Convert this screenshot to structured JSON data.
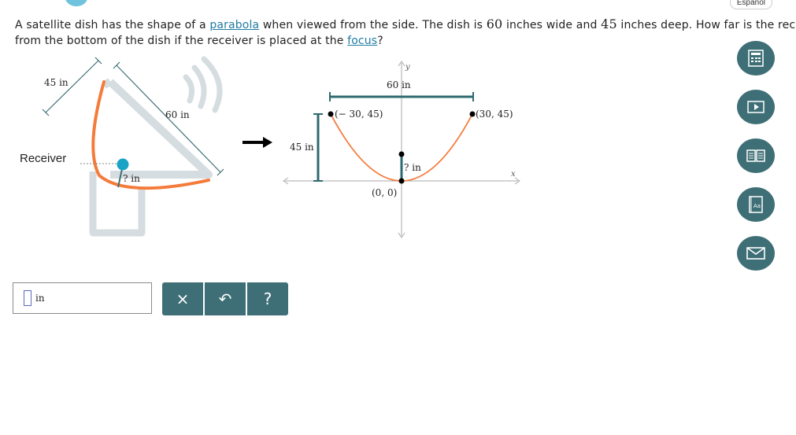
{
  "header": {
    "language_link": "Español"
  },
  "problem": {
    "part1": "A satellite dish has the shape of a ",
    "link_parabola": "parabola",
    "part2": " when viewed from the side. The dish is ",
    "width_value": "60",
    "part3": " inches wide and ",
    "depth_value": "45",
    "part4": " inches deep. How far is the receiver",
    "line2_part1": "from the bottom of the dish if the receiver is placed at the ",
    "link_focus": "focus",
    "line2_part2": "?"
  },
  "figure_left": {
    "label_depth": "45 in",
    "label_width": "60 in",
    "label_receiver": "Receiver",
    "label_unknown": "? in"
  },
  "figure_right": {
    "axis_y": "y",
    "axis_x": "x",
    "label_width": "60 in",
    "label_depth": "45 in",
    "point_left": "(− 30, 45)",
    "point_right": "(30, 45)",
    "point_origin": "(0, 0)",
    "label_unknown": "? in"
  },
  "answer": {
    "value": "",
    "unit": "in"
  },
  "actions": {
    "clear": "×",
    "undo": "↶",
    "help": "?"
  },
  "colors": {
    "teal_dark": "#3f6f76",
    "parabola_orange": "#f47b3a",
    "receiver_blue": "#1ba3c6",
    "dish_gray": "#d5dde1",
    "link_blue": "#1f7ba3"
  },
  "side_tools": [
    "calculator-icon",
    "video-icon",
    "textbook-icon",
    "glossary-icon",
    "message-icon"
  ]
}
